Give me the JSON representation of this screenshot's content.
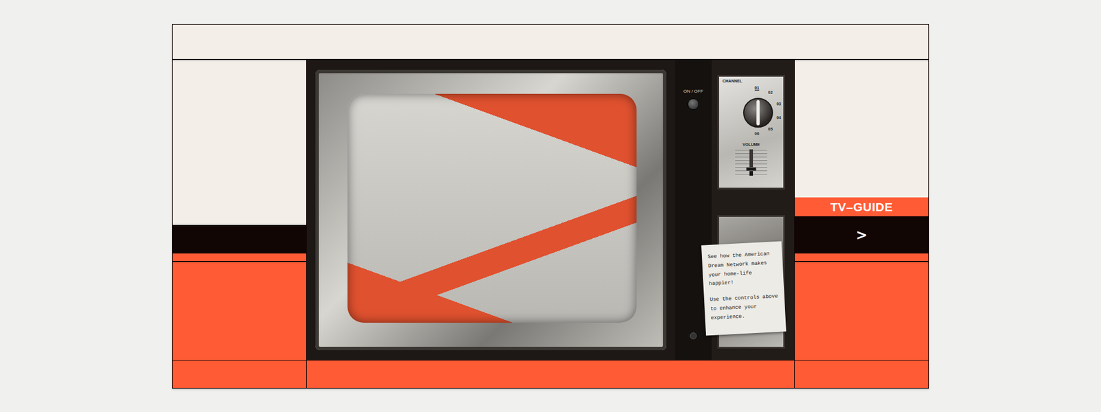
{
  "tv": {
    "power_label": "ON / OFF",
    "channel_label": "CHANNEL",
    "channels": [
      {
        "label": "01",
        "selected": true
      },
      {
        "label": "02",
        "selected": false
      },
      {
        "label": "03",
        "selected": false
      },
      {
        "label": "04",
        "selected": false
      },
      {
        "label": "05",
        "selected": false
      },
      {
        "label": "06",
        "selected": false
      }
    ],
    "volume_label": "VOLUME",
    "volume": {
      "level": 0.2
    },
    "note": [
      "See how the American Dream Network makes your home-life happier!",
      "Use the controls above to enhance your experience."
    ]
  },
  "guide": {
    "label": "TV–GUIDE",
    "arrow": ">"
  }
}
